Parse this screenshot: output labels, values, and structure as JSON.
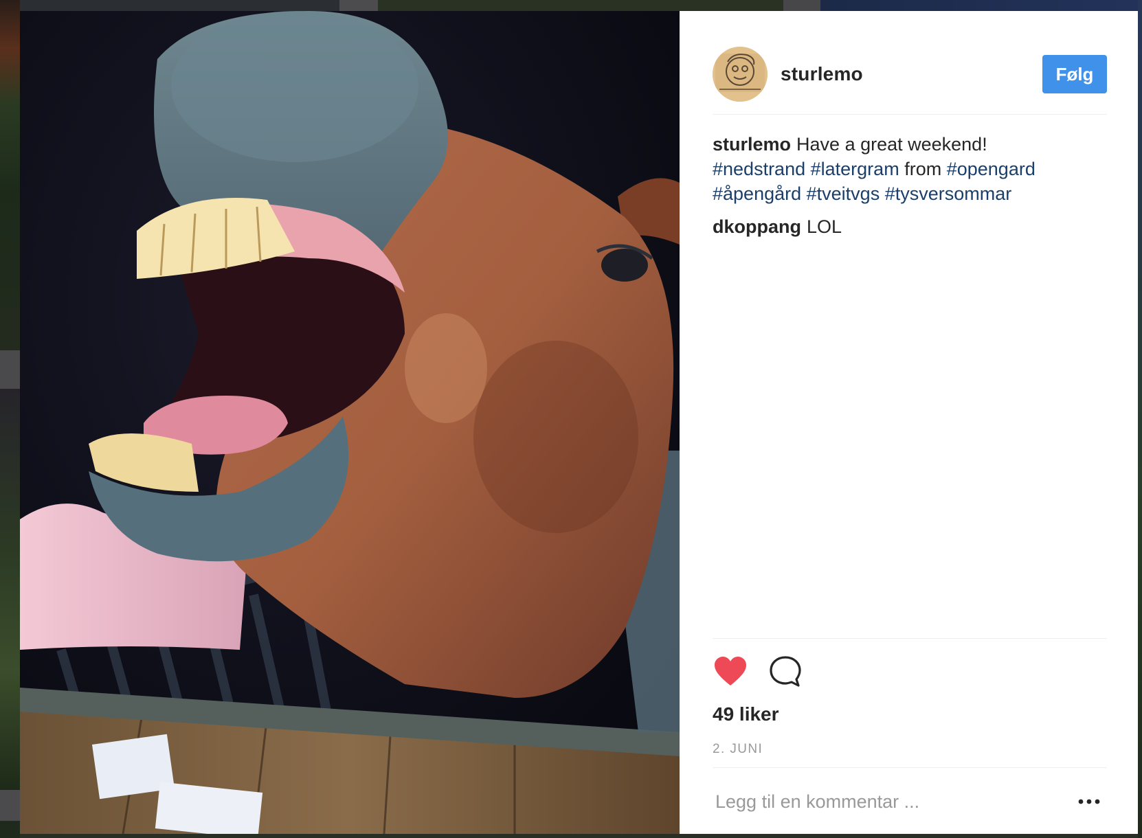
{
  "post": {
    "image_alt": "Horse with mouth wide open",
    "author": "sturlemo",
    "follow_label": "Følg",
    "caption": {
      "user": "sturlemo",
      "text_1": "Have a great weekend!",
      "tag_1": "#nedstrand",
      "tag_2": "#latergram",
      "text_2": "from",
      "tag_3": "#opengard",
      "tag_4": "#åpengård",
      "tag_5": "#tveitvgs",
      "tag_6": "#tysversommar"
    },
    "comments": [
      {
        "user": "dkoppang",
        "text": "LOL"
      }
    ],
    "likes": "49 liker",
    "date": "2. JUNI",
    "comment_placeholder": "Legg til en kommentar ...",
    "icons": {
      "like": "heart-icon",
      "comment": "speech-bubble-icon",
      "more": "more-options-icon"
    },
    "colors": {
      "follow_button": "#3f91ea",
      "liked_heart": "#ed4956",
      "hashtag": "#1b3f6b",
      "text": "#262626",
      "muted": "#999999"
    }
  }
}
